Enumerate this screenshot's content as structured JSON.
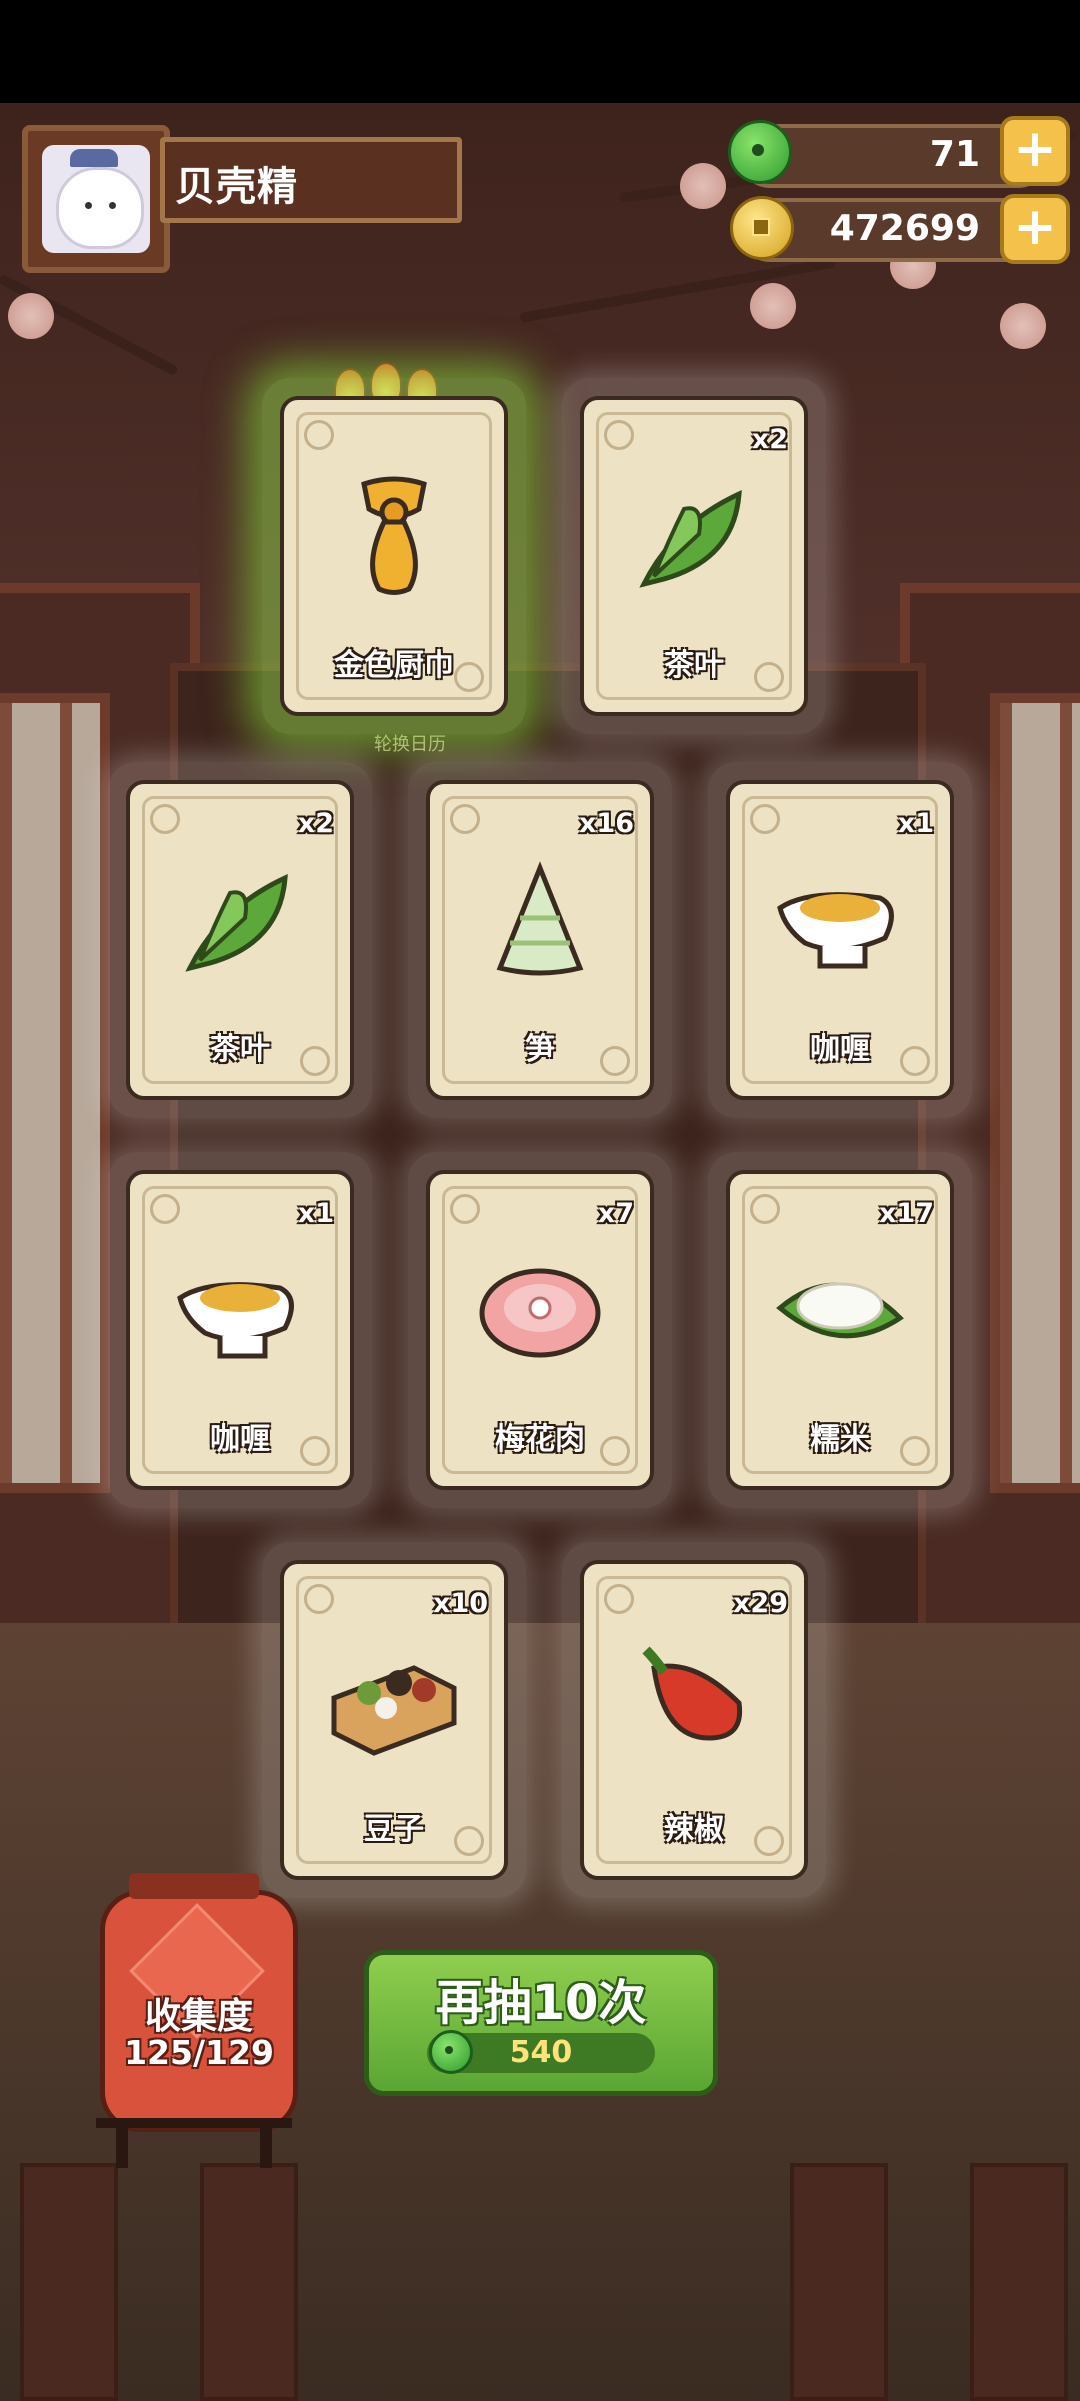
{
  "player": {
    "name": "贝壳精",
    "avatar_icon": "cat-chef-avatar"
  },
  "resources": {
    "jade": {
      "value": "71",
      "icon": "jade-icon"
    },
    "coins": {
      "value": "472699",
      "icon": "coin-icon"
    }
  },
  "featured_subtitle": "轮换日历",
  "cards": [
    {
      "name": "金色厨巾",
      "count": "",
      "rarity": "gold",
      "icon": "golden-scarf-icon"
    },
    {
      "name": "茶叶",
      "count": "x2",
      "icon": "tea-leaf-icon"
    },
    {
      "name": "茶叶",
      "count": "x2",
      "icon": "tea-leaf-icon"
    },
    {
      "name": "笋",
      "count": "x16",
      "icon": "bamboo-shoot-icon"
    },
    {
      "name": "咖喱",
      "count": "x1",
      "icon": "curry-gravy-icon"
    },
    {
      "name": "咖喱",
      "count": "x1",
      "icon": "curry-gravy-icon"
    },
    {
      "name": "梅花肉",
      "count": "x7",
      "icon": "pork-icon"
    },
    {
      "name": "糯米",
      "count": "x17",
      "icon": "sticky-rice-icon"
    },
    {
      "name": "豆子",
      "count": "x10",
      "icon": "beans-box-icon"
    },
    {
      "name": "辣椒",
      "count": "x29",
      "icon": "chili-icon"
    }
  ],
  "collection": {
    "title": "收集度",
    "progress": "125/129"
  },
  "draw_button": {
    "label": "再抽10次",
    "cost": "540"
  },
  "colors": {
    "accent_green": "#5aa633",
    "gold": "#f4c24a",
    "card_bg": "#ede2c4"
  }
}
